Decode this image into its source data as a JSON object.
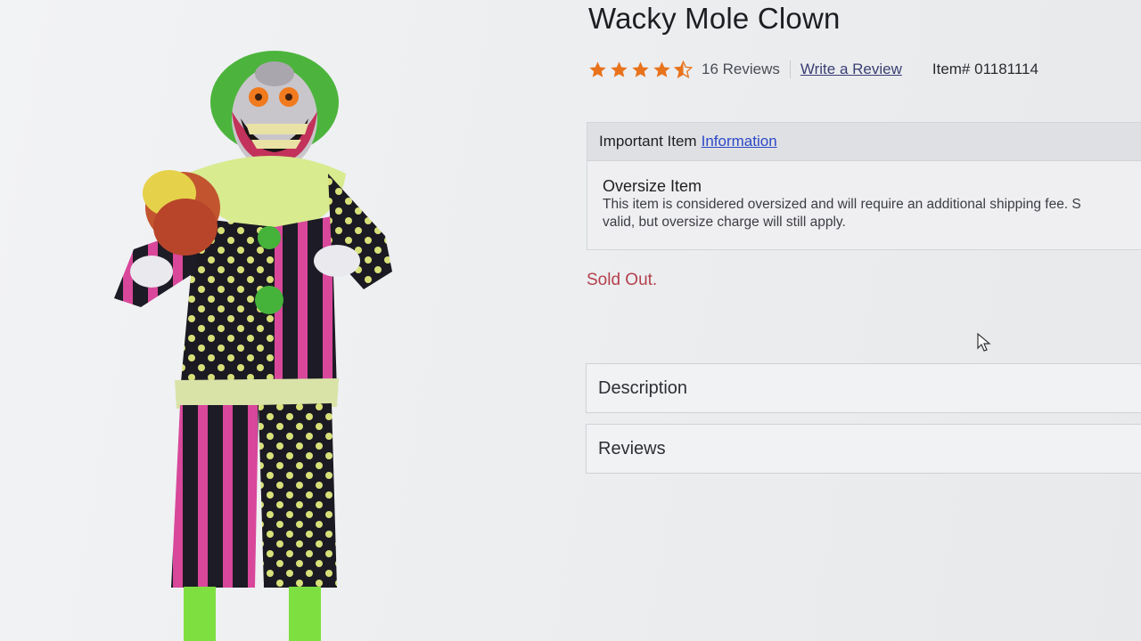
{
  "product": {
    "title": "Wacky Mole Clown",
    "image_alt": "Wacky Mole Clown animatronic",
    "rating": 4.5,
    "rating_max": 5,
    "star_color": "#e8731c",
    "reviews_count_text": "16 Reviews",
    "write_review_label": "Write a Review",
    "item_number_text": "Item# 01181114",
    "sold_out_text": "Sold Out."
  },
  "important_info": {
    "header_prefix": "Important Item",
    "header_link": "Information",
    "oversize_title": "Oversize Item",
    "oversize_text_line1": "This item is considered oversized and will require an additional shipping fee. S",
    "oversize_text_line2": "valid, but oversize charge will still apply."
  },
  "accordions": {
    "description_label": "Description",
    "reviews_label": "Reviews"
  },
  "icons": {
    "star": "star-icon",
    "cursor": "mouse-cursor-icon"
  }
}
